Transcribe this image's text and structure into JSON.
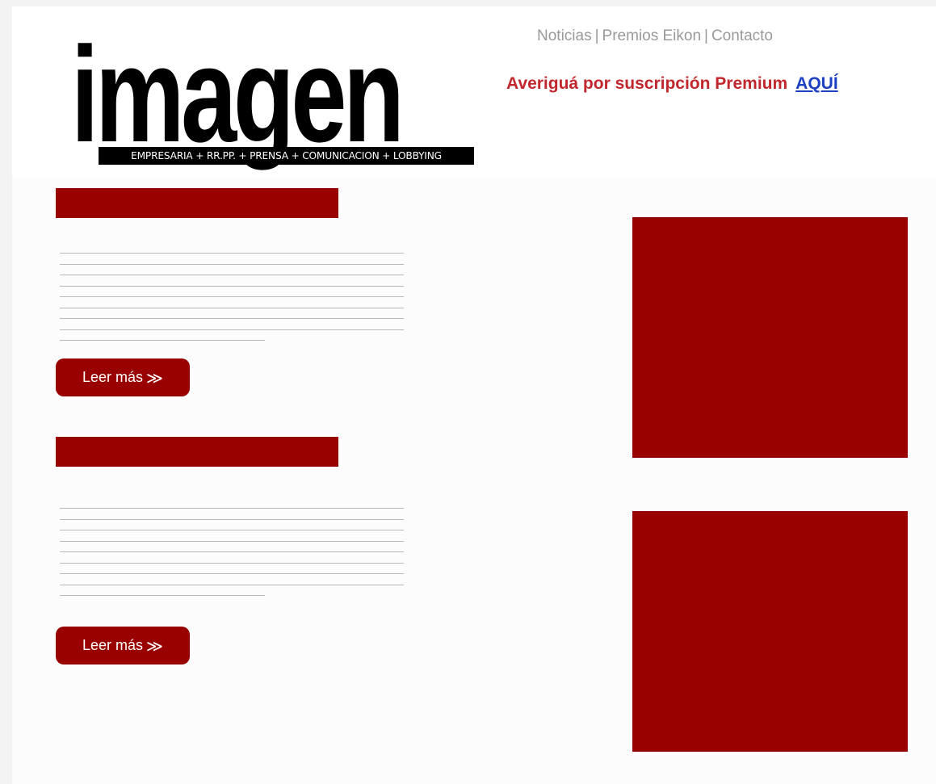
{
  "brand": {
    "logo_word": "imagen",
    "tagline": "EMPRESARIA + RR.PP. + PRENSA + COMUNICACION + LOBBYING"
  },
  "nav": {
    "items": [
      {
        "label": "Noticias"
      },
      {
        "label": "Premios Eikon"
      },
      {
        "label": "Contacto"
      }
    ],
    "separator": "|"
  },
  "promo": {
    "text": "Averiguá por suscripción Premium",
    "link_label": "AQUÍ"
  },
  "articles": [
    {
      "read_more_label": "Leer más",
      "chevron": "≫"
    },
    {
      "read_more_label": "Leer más",
      "chevron": "≫"
    }
  ],
  "colors": {
    "accent": "#990000",
    "promo_text": "#c1282e",
    "link": "#1d3fc2",
    "nav_text": "#999999"
  }
}
